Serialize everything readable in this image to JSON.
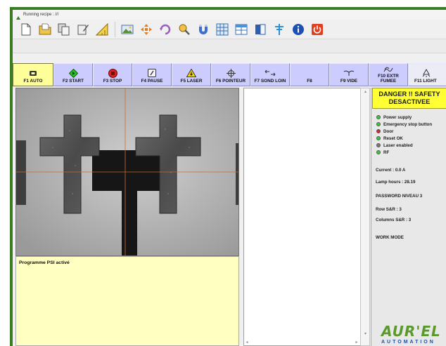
{
  "window": {
    "title": "Running recipe : ///"
  },
  "toolbar": {
    "buttons": [
      {
        "name": "new-file-icon",
        "color": "#ffffff"
      },
      {
        "name": "open-folder-icon",
        "color": "#e8b940"
      },
      {
        "name": "copy-icon",
        "color": "#cfcfcf"
      },
      {
        "name": "edit-icon",
        "color": "#d9d9d9"
      },
      {
        "name": "ruler-icon",
        "color": "#f2d24b"
      },
      {
        "name": "image-icon",
        "color": "#6fa7e0"
      },
      {
        "name": "move-arrows-icon",
        "color": "#e07d26"
      },
      {
        "name": "rotate-icon",
        "color": "#9a5ec0"
      },
      {
        "name": "probe-icon",
        "color": "#e6a13a"
      },
      {
        "name": "magnet-icon",
        "color": "#3a6fd0"
      },
      {
        "name": "grid-icon",
        "color": "#4f8fd8"
      },
      {
        "name": "table-icon",
        "color": "#4f8fd8"
      },
      {
        "name": "book-icon",
        "color": "#2c5fb0"
      },
      {
        "name": "antenna-icon",
        "color": "#2c8fd8"
      },
      {
        "name": "info-icon",
        "color": "#1f4fb0"
      },
      {
        "name": "power-icon",
        "color": "#e04020"
      }
    ]
  },
  "function_keys": [
    {
      "id": "f1",
      "label": "F1 AUTO",
      "icon": "auto-icon",
      "active": true
    },
    {
      "id": "f2",
      "label": "F2 START",
      "icon": "start-icon",
      "active": false
    },
    {
      "id": "f3",
      "label": "F3 STOP",
      "icon": "stop-icon",
      "active": false
    },
    {
      "id": "f4",
      "label": "F4 PAUSE",
      "icon": "pause-icon",
      "active": false
    },
    {
      "id": "f5",
      "label": "F5 LASER",
      "icon": "laser-warning-icon",
      "active": false
    },
    {
      "id": "f6",
      "label": "F6 POINTEUR",
      "icon": "crosshair-icon",
      "active": false
    },
    {
      "id": "f7",
      "label": "F7 SOND LOIN",
      "icon": "arrows-horizontal-icon",
      "active": false
    },
    {
      "id": "f8",
      "label": "F8",
      "icon": "",
      "active": false
    },
    {
      "id": "f9",
      "label": "F9 VIDE",
      "icon": "vacuum-icon",
      "active": false
    },
    {
      "id": "f10",
      "label": "F10 EXTR\nFUMEE",
      "icon": "fume-extractor-icon",
      "active": false
    },
    {
      "id": "f11",
      "label": "F11 LIGHT",
      "icon": "light-icon",
      "active": false
    }
  ],
  "message": {
    "text": "Programme PSI activé"
  },
  "status": {
    "danger_line1": "DANGER !! SAFETY",
    "danger_line2": "DESACTIVEE",
    "checks": [
      {
        "label": "Power supply",
        "color": "#33cc33"
      },
      {
        "label": "Emergency stop button",
        "color": "#33cc33"
      },
      {
        "label": "Door",
        "color": "#dd2222"
      },
      {
        "label": "Reset OK",
        "color": "#33cc33"
      },
      {
        "label": "Laser enabled",
        "color": "#777777"
      },
      {
        "label": "RF",
        "color": "#33cc33"
      }
    ],
    "current": "Current : 0.0 A",
    "lamp_hours": "Lamp hours : 28.19",
    "password": "PASSWORD NIVEAU 3",
    "rows": "Row S&R : 3",
    "columns": "Columns S&R : 3",
    "work_mode": "WORK MODE"
  },
  "logo": {
    "main": "AUR'EL",
    "sub": "AUTOMATION"
  },
  "colors": {
    "frame": "#3b7d22",
    "fkey_bg": "#ccccff",
    "fkey_active": "#ffff99",
    "danger_bg": "#ffff33",
    "message_bg": "#ffffc2",
    "crosshair": "#d2692a"
  }
}
